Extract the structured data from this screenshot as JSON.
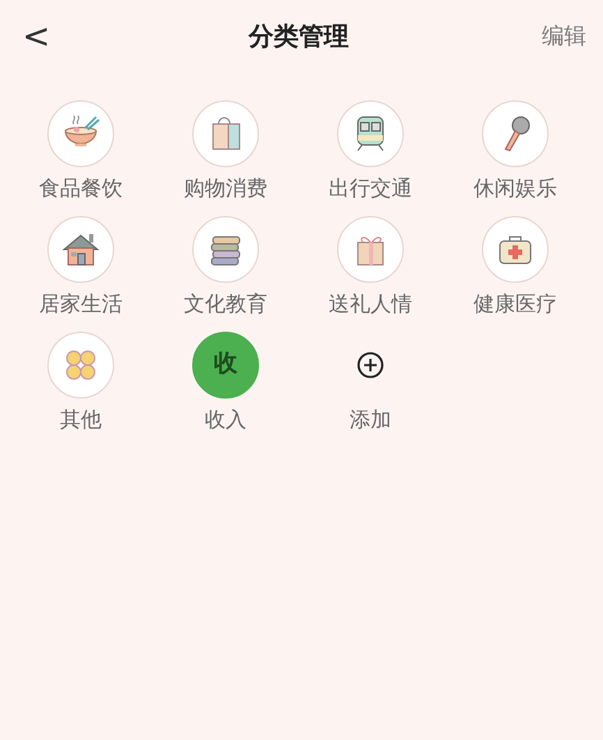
{
  "header": {
    "back": "<",
    "title": "分类管理",
    "action": "编辑"
  },
  "categories": [
    {
      "kind": "category",
      "label": "食品餐饮"
    },
    {
      "kind": "category",
      "label": "购物消费"
    },
    {
      "kind": "category",
      "label": "出行交通"
    },
    {
      "kind": "category",
      "label": "休闲娱乐"
    },
    {
      "kind": "category",
      "label": "居家生活"
    },
    {
      "kind": "category",
      "label": "文化教育"
    },
    {
      "kind": "category",
      "label": "送礼人情"
    },
    {
      "kind": "category",
      "label": "健康医疗"
    },
    {
      "kind": "category",
      "label": "其他"
    },
    {
      "kind": "letter",
      "mark": "收",
      "label": "收入"
    },
    {
      "kind": "add",
      "label": "添加"
    }
  ]
}
